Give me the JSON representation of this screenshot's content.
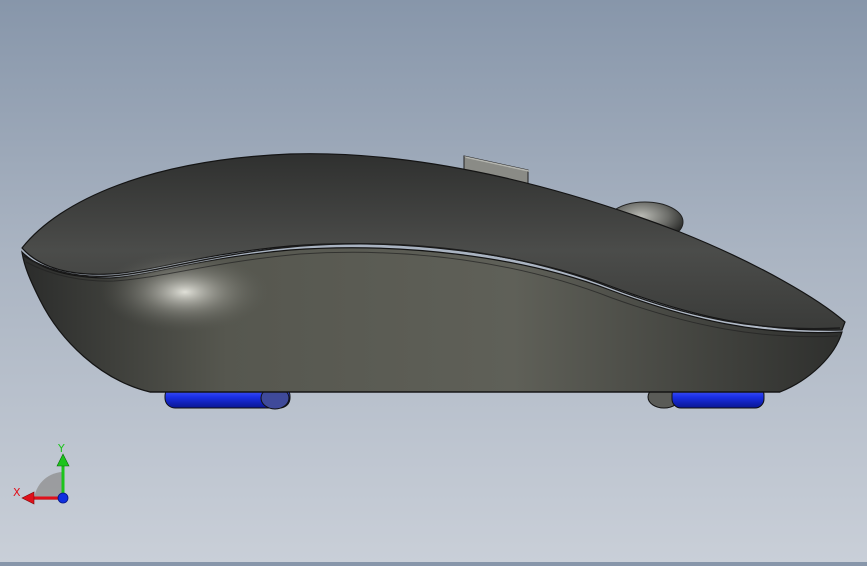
{
  "viewport": {
    "model_name": "wireless-mouse",
    "view": "side"
  },
  "triad": {
    "x_label": "X",
    "y_label": "Y",
    "x_color": "#e0101a",
    "y_color": "#1cc41c",
    "z_color": "#1030e0"
  },
  "colors": {
    "background_top": "#8796aa",
    "background_bottom": "#c9cfd8",
    "mouse_body": "#4a4b4a",
    "feet": "#1a2fe6"
  }
}
